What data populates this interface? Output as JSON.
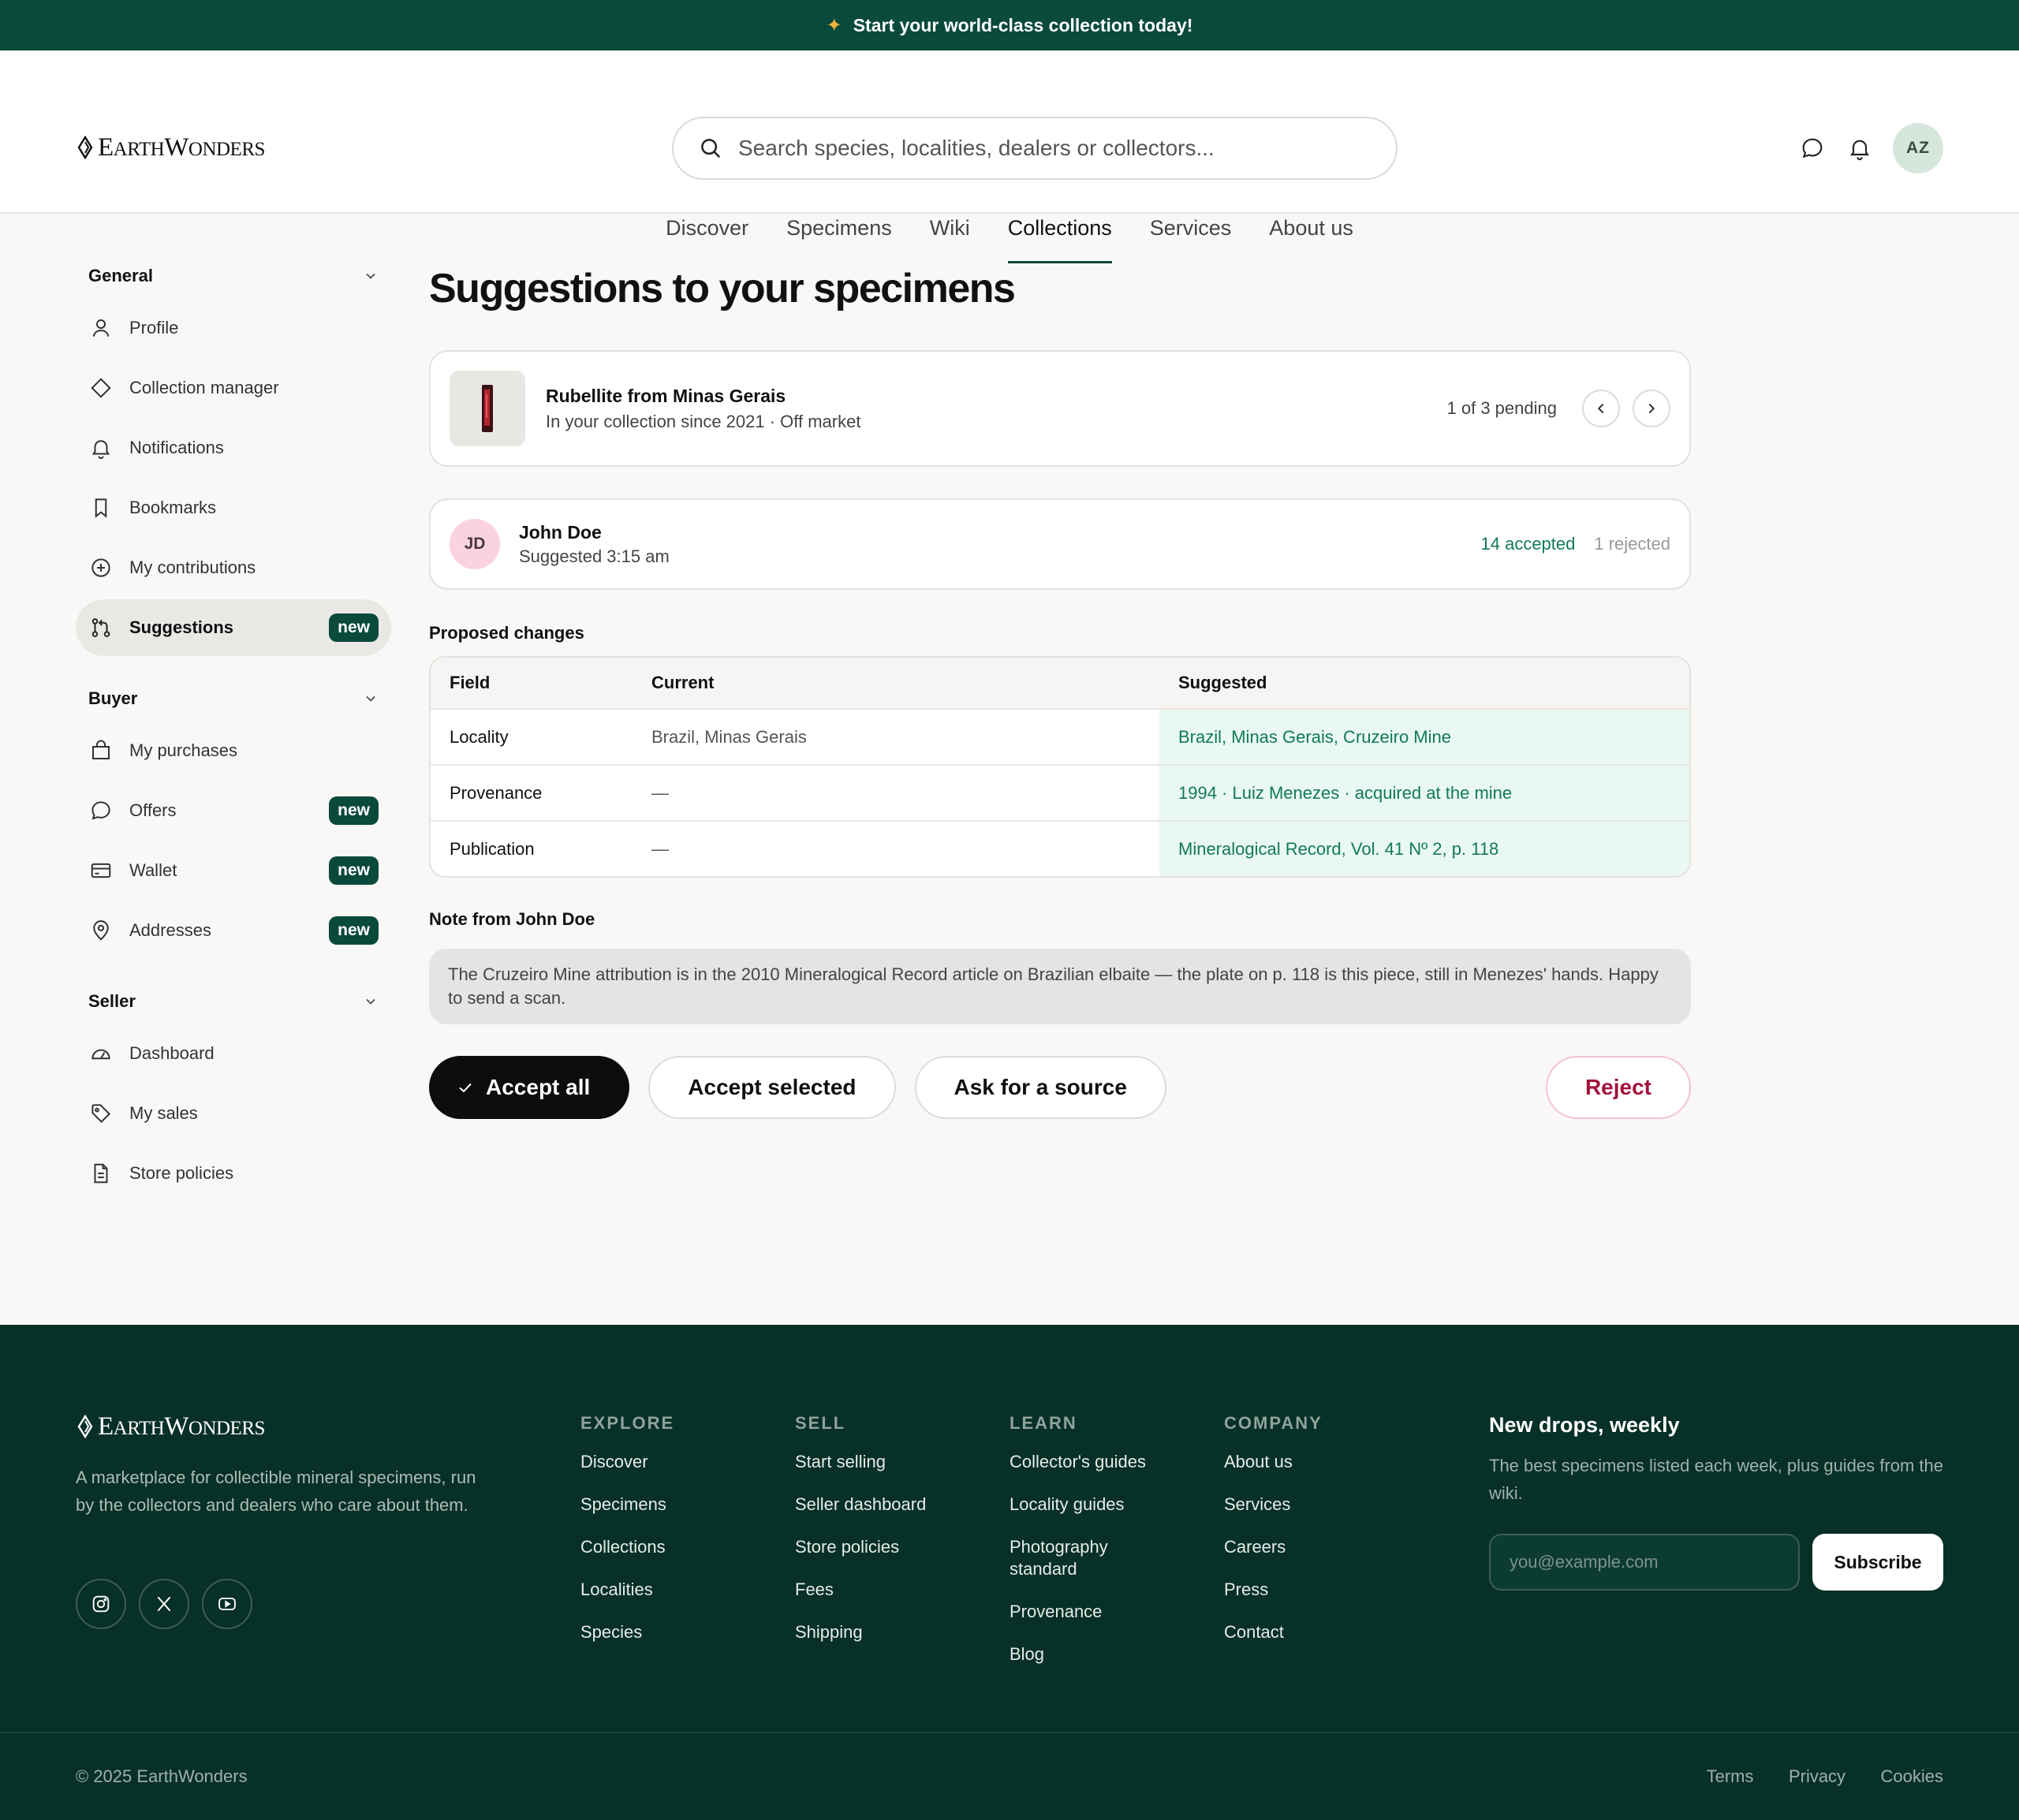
{
  "promo": {
    "icon": "sparkle-icon",
    "text": "Start your world-class collection today!"
  },
  "brand": {
    "cap1": "E",
    "rest1": "ARTH",
    "cap2": "W",
    "rest2": "ONDERS"
  },
  "search": {
    "placeholder": "Search species, localities, dealers or collectors..."
  },
  "header": {
    "avatar_initials": "AZ"
  },
  "nav": [
    "Discover",
    "Specimens",
    "Wiki",
    "Collections",
    "Services",
    "About us"
  ],
  "nav_active": "Collections",
  "sidebar": {
    "general": {
      "title": "General",
      "items": [
        {
          "label": "Profile",
          "icon": "user-icon"
        },
        {
          "label": "Collection manager",
          "icon": "diamond-icon"
        },
        {
          "label": "Notifications",
          "icon": "bell-icon"
        },
        {
          "label": "Bookmarks",
          "icon": "bookmark-icon"
        },
        {
          "label": "My contributions",
          "icon": "plus-circle-icon"
        },
        {
          "label": "Suggestions",
          "icon": "git-pull-request-icon",
          "badge": "new",
          "active": true
        }
      ]
    },
    "buyer": {
      "title": "Buyer",
      "items": [
        {
          "label": "My purchases",
          "icon": "shopping-bag-icon"
        },
        {
          "label": "Offers",
          "icon": "chat-bubble-icon",
          "badge": "new"
        },
        {
          "label": "Wallet",
          "icon": "credit-card-icon",
          "badge": "new"
        },
        {
          "label": "Addresses",
          "icon": "map-pin-icon",
          "badge": "new"
        }
      ]
    },
    "seller": {
      "title": "Seller",
      "items": [
        {
          "label": "Dashboard",
          "icon": "gauge-icon"
        },
        {
          "label": "My sales",
          "icon": "tag-icon"
        },
        {
          "label": "Store policies",
          "icon": "document-icon"
        }
      ]
    }
  },
  "main": {
    "title": "Suggestions to your specimens",
    "specimen": {
      "name": "Rubellite from Minas Gerais",
      "meta": "In your collection since 2021 · Off market",
      "pending": "1 of 3 pending"
    },
    "suggester": {
      "initials": "JD",
      "name": "John Doe",
      "time": "Suggested 3:15 am",
      "accepted": "14 accepted",
      "rejected": "1 rejected"
    },
    "changes_label": "Proposed changes",
    "changes_headers": [
      "Field",
      "Current",
      "Suggested"
    ],
    "changes": [
      {
        "field": "Locality",
        "current": "Brazil, Minas Gerais",
        "suggested": "Brazil, Minas Gerais, Cruzeiro Mine"
      },
      {
        "field": "Provenance",
        "current": "—",
        "suggested": "1994 · Luiz Menezes · acquired at the mine"
      },
      {
        "field": "Publication",
        "current": "—",
        "suggested": "Mineralogical Record, Vol. 41 Nº 2, p. 118"
      }
    ],
    "note_label": "Note from John Doe",
    "note": "The Cruzeiro Mine attribution is in the 2010 Mineralogical Record article on Brazilian elbaite — the plate on p. 118 is this piece, still in Menezes' hands. Happy to send a scan.",
    "actions": {
      "accept_all": "Accept all",
      "accept_selected": "Accept selected",
      "ask_source": "Ask for a source",
      "reject": "Reject"
    }
  },
  "footer": {
    "description": "A marketplace for collectible mineral specimens, run by the collectors and dealers who care about them.",
    "socials": [
      "instagram-icon",
      "x-icon",
      "youtube-icon"
    ],
    "columns": [
      {
        "title": "EXPLORE",
        "links": [
          "Discover",
          "Specimens",
          "Collections",
          "Localities",
          "Species"
        ]
      },
      {
        "title": "SELL",
        "links": [
          "Start selling",
          "Seller dashboard",
          "Store policies",
          "Fees",
          "Shipping"
        ]
      },
      {
        "title": "LEARN",
        "links": [
          "Collector's guides",
          "Locality guides",
          "Photography standard",
          "Provenance",
          "Blog"
        ]
      },
      {
        "title": "COMPANY",
        "links": [
          "About us",
          "Services",
          "Careers",
          "Press",
          "Contact"
        ]
      }
    ],
    "newsletter": {
      "title": "New drops, weekly",
      "text": "The best specimens listed each week, plus guides from the wiki.",
      "placeholder": "you@example.com",
      "button": "Subscribe"
    },
    "copyright": "© 2025 EarthWonders",
    "legal": [
      "Terms",
      "Privacy",
      "Cookies"
    ]
  },
  "colors": {
    "brand": "#0a4a3b",
    "accent_green": "#127a58",
    "reject": "#a3123c",
    "footer_bg": "#073027"
  }
}
